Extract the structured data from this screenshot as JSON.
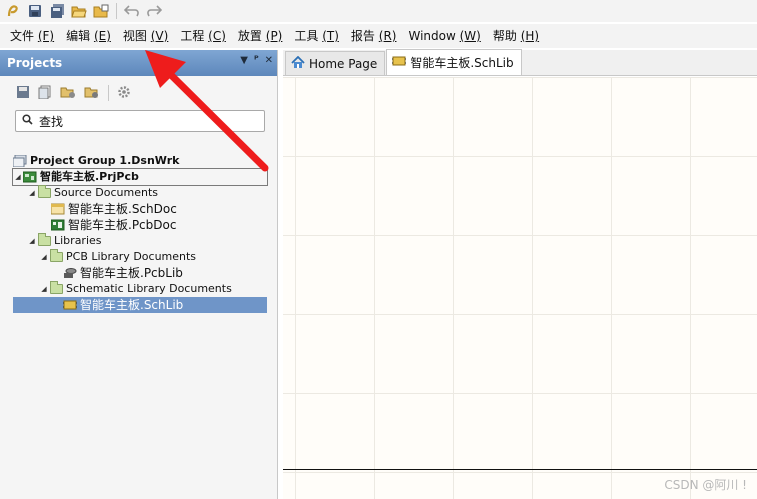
{
  "quick_access": {
    "icons": [
      "app-logo-icon",
      "save-icon",
      "save-all-icon",
      "open-icon",
      "open-project-icon",
      "undo-icon",
      "redo-icon"
    ]
  },
  "menubar": {
    "items": [
      {
        "label": "文件",
        "hotkey": "(F)"
      },
      {
        "label": "编辑",
        "hotkey": "(E)"
      },
      {
        "label": "视图",
        "hotkey": "(V)"
      },
      {
        "label": "工程",
        "hotkey": "(C)"
      },
      {
        "label": "放置",
        "hotkey": "(P)"
      },
      {
        "label": "工具",
        "hotkey": "(T)"
      },
      {
        "label": "报告",
        "hotkey": "(R)"
      },
      {
        "label": "Window",
        "hotkey": "(W)"
      },
      {
        "label": "帮助",
        "hotkey": "(H)"
      }
    ]
  },
  "projects_panel": {
    "title": "Projects",
    "search_placeholder": "查找",
    "tree": [
      {
        "label": "Project Group 1.DsnWrk",
        "level": 0,
        "icon": "project-group-icon",
        "expanded": null,
        "bold": true
      },
      {
        "label": "智能车主板.PrjPcb",
        "level": 0,
        "icon": "pcb-project-icon",
        "expanded": true,
        "bold": true,
        "focused": true
      },
      {
        "label": "Source Documents",
        "level": 1,
        "icon": "folder-icon",
        "expanded": true
      },
      {
        "label": "智能车主板.SchDoc",
        "level": 2,
        "icon": "schdoc-icon",
        "expanded": null
      },
      {
        "label": "智能车主板.PcbDoc",
        "level": 2,
        "icon": "pcbdoc-icon",
        "expanded": null
      },
      {
        "label": "Libraries",
        "level": 1,
        "icon": "folder-icon",
        "expanded": true
      },
      {
        "label": "PCB Library Documents",
        "level": 2,
        "icon": "folder-icon",
        "expanded": true
      },
      {
        "label": "智能车主板.PcbLib",
        "level": 3,
        "icon": "pcblib-icon",
        "expanded": null
      },
      {
        "label": "Schematic Library Documents",
        "level": 2,
        "icon": "folder-icon",
        "expanded": true
      },
      {
        "label": "智能车主板.SchLib",
        "level": 3,
        "icon": "schlib-icon",
        "expanded": null,
        "selected": true
      }
    ]
  },
  "tabs": [
    {
      "label": "Home Page",
      "icon": "home-icon",
      "active": false
    },
    {
      "label": "智能车主板.SchLib",
      "icon": "schlib-icon",
      "active": true
    }
  ],
  "watermark": "CSDN @阿川 !"
}
